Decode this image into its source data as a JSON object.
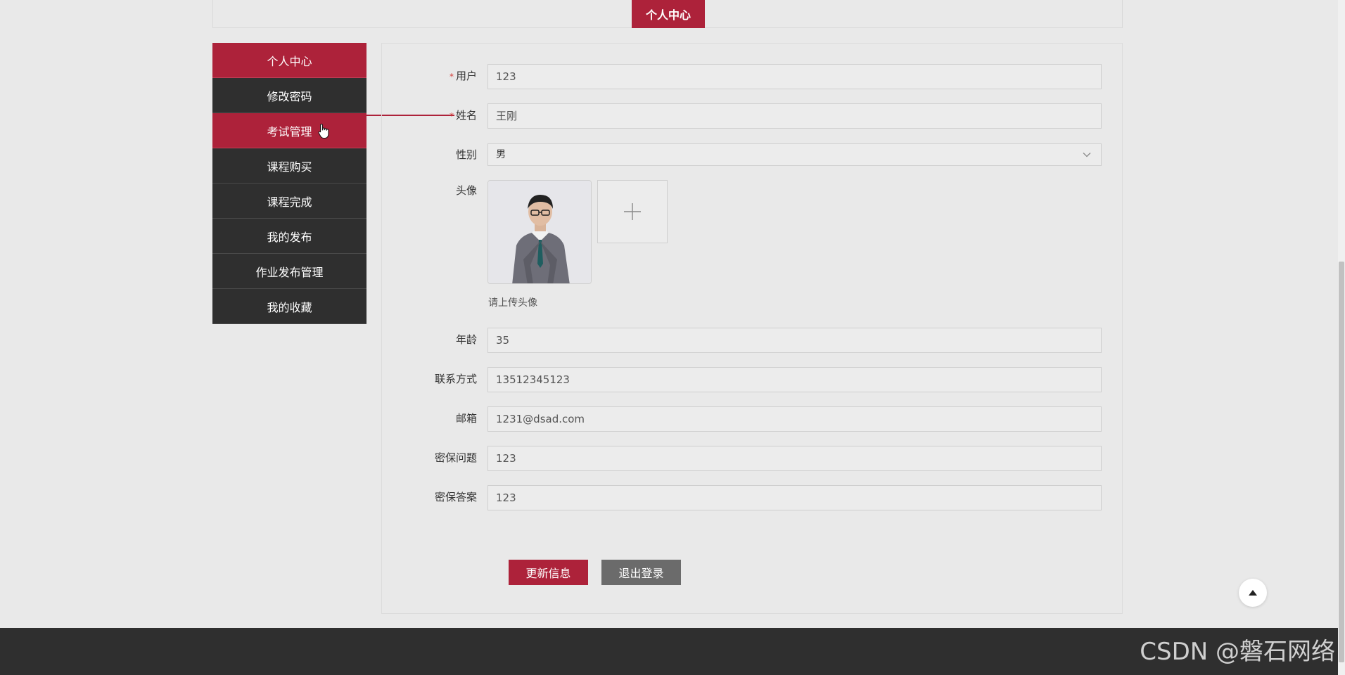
{
  "header": {
    "title": "个人中心"
  },
  "sidebar": {
    "items": [
      {
        "label": "个人中心",
        "active": true
      },
      {
        "label": "修改密码",
        "active": false
      },
      {
        "label": "考试管理",
        "active": true
      },
      {
        "label": "课程购买",
        "active": false
      },
      {
        "label": "课程完成",
        "active": false
      },
      {
        "label": "我的发布",
        "active": false
      },
      {
        "label": "作业发布管理",
        "active": false
      },
      {
        "label": "我的收藏",
        "active": false
      }
    ]
  },
  "form": {
    "username": {
      "label": "用户",
      "required": true,
      "value": "123"
    },
    "name": {
      "label": "姓名",
      "required": true,
      "value": "王刚"
    },
    "gender": {
      "label": "性别",
      "value": "男"
    },
    "avatar": {
      "label": "头像",
      "hint": "请上传头像"
    },
    "age": {
      "label": "年龄",
      "value": "35"
    },
    "contact": {
      "label": "联系方式",
      "value": "13512345123"
    },
    "email": {
      "label": "邮箱",
      "value": "1231@dsad.com"
    },
    "security_question": {
      "label": "密保问题",
      "value": "123"
    },
    "security_answer": {
      "label": "密保答案",
      "value": "123"
    }
  },
  "buttons": {
    "update": "更新信息",
    "logout": "退出登录"
  },
  "watermark": "CSDN @磐石网络",
  "colors": {
    "accent": "#ad223a",
    "sidebar_bg": "#2f2f2f",
    "logout_bg": "#6b6b6b"
  },
  "required_mark": "*"
}
